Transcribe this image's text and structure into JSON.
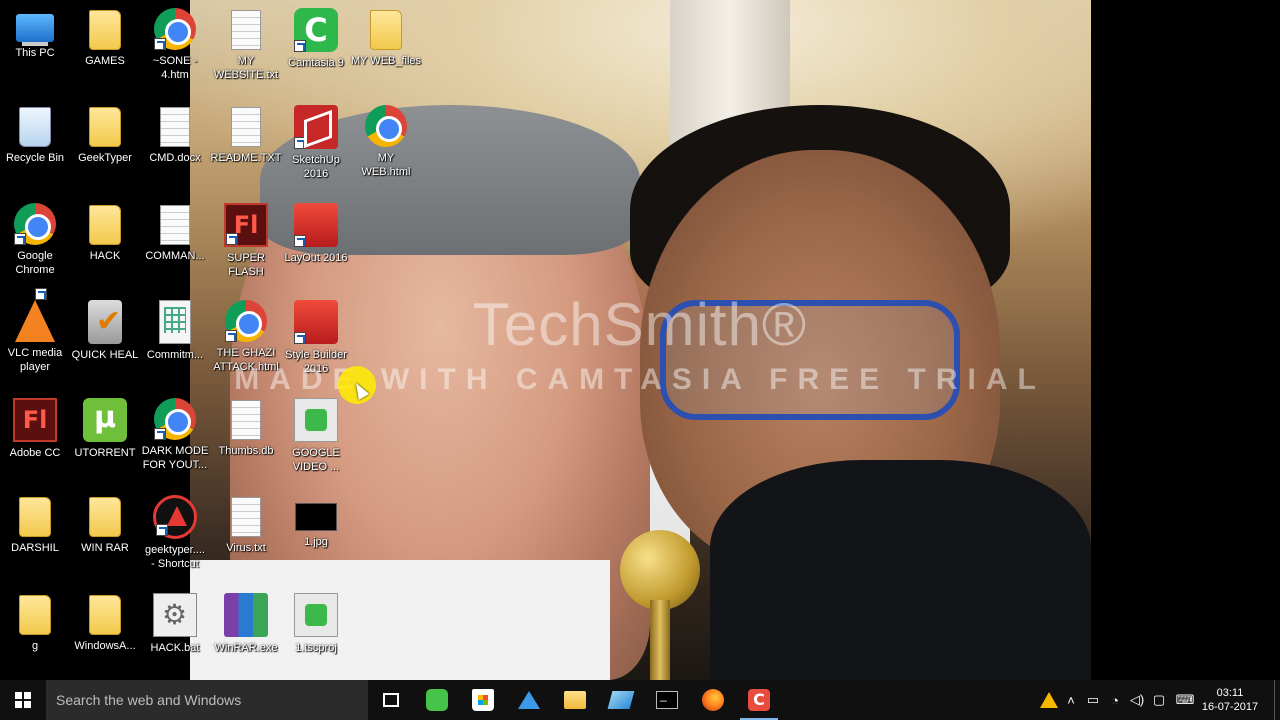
{
  "watermark": {
    "brand": "TechSmith®",
    "trial": "MADE WITH CAMTASIA FREE TRIAL"
  },
  "desktop_icons": [
    {
      "id": "this-pc",
      "label": "This PC",
      "icon": "computer-icon"
    },
    {
      "id": "games",
      "label": "GAMES",
      "icon": "folder-icon"
    },
    {
      "id": "sone",
      "label": "~SONE -\n4.htm",
      "icon": "chrome-icon"
    },
    {
      "id": "my-website",
      "label": "MY\nWEBSITE.txt",
      "icon": "text-file-icon"
    },
    {
      "id": "camtasia9",
      "label": "Camtasia 9",
      "icon": "camtasia-icon"
    },
    {
      "id": "my-web-files",
      "label": "MY WEB_files",
      "icon": "folder-icon"
    },
    {
      "id": "recycle-bin",
      "label": "Recycle Bin",
      "icon": "recycle-bin-icon"
    },
    {
      "id": "geektyper",
      "label": "GeekTyper",
      "icon": "folder-icon"
    },
    {
      "id": "cmd-docx",
      "label": "CMD.docx",
      "icon": "word-doc-icon"
    },
    {
      "id": "readme",
      "label": "README.TXT",
      "icon": "text-file-icon"
    },
    {
      "id": "sketchup",
      "label": "SketchUp\n2016",
      "icon": "sketchup-icon"
    },
    {
      "id": "my-web-html",
      "label": "MY\nWEB.html",
      "icon": "chrome-icon"
    },
    {
      "id": "google-chrome",
      "label": "Google\nChrome",
      "icon": "chrome-icon"
    },
    {
      "id": "hack",
      "label": "HACK",
      "icon": "folder-icon"
    },
    {
      "id": "command",
      "label": "COMMAN...",
      "icon": "text-file-icon"
    },
    {
      "id": "super-flash",
      "label": "SUPER\nFLASH",
      "icon": "flash-icon"
    },
    {
      "id": "layout",
      "label": "LayOut 2016",
      "icon": "layout-icon"
    },
    {
      "id": "vlc",
      "label": "VLC media\nplayer",
      "icon": "vlc-icon"
    },
    {
      "id": "quick-heal",
      "label": "QUICK HEAL",
      "icon": "quick-heal-icon"
    },
    {
      "id": "commitment",
      "label": "Commitm...",
      "icon": "spreadsheet-icon"
    },
    {
      "id": "ghazi",
      "label": "THE GHAZI\nATTACK.html",
      "icon": "chrome-icon"
    },
    {
      "id": "style-builder",
      "label": "Style Builder\n2016",
      "icon": "style-builder-icon"
    },
    {
      "id": "adobe-cc",
      "label": "Adobe CC",
      "icon": "flash-icon"
    },
    {
      "id": "utorrent",
      "label": "UTORRENT",
      "icon": "utorrent-icon"
    },
    {
      "id": "dark-mode",
      "label": "DARK MODE\nFOR YOUT...",
      "icon": "chrome-icon"
    },
    {
      "id": "thumbs",
      "label": "Thumbs.db",
      "icon": "database-file-icon"
    },
    {
      "id": "google-video",
      "label": "GOOGLE\nVIDEO ...",
      "icon": "video-file-icon"
    },
    {
      "id": "darshil",
      "label": "DARSHIL",
      "icon": "folder-icon"
    },
    {
      "id": "winrar-folder",
      "label": "WIN RAR",
      "icon": "folder-icon"
    },
    {
      "id": "geektyper-shortcut",
      "label": "geektyper....\n- Shortcut",
      "icon": "geektyper-icon"
    },
    {
      "id": "virus",
      "label": "Virus.txt",
      "icon": "text-file-icon"
    },
    {
      "id": "one-jpg",
      "label": "1.jpg",
      "icon": "image-file-icon"
    },
    {
      "id": "g",
      "label": "g",
      "icon": "folder-icon"
    },
    {
      "id": "windowsa",
      "label": "WindowsA...",
      "icon": "folder-icon"
    },
    {
      "id": "hack-bat",
      "label": "HACK.bat",
      "icon": "batch-file-icon"
    },
    {
      "id": "winrar-exe",
      "label": "WinRAR.exe",
      "icon": "winrar-icon"
    },
    {
      "id": "tscproj",
      "label": "1.tscproj",
      "icon": "camtasia-project-icon"
    }
  ],
  "taskbar": {
    "search_placeholder": "Search the web and Windows",
    "pinned": [
      "task-view-icon",
      "evernote-icon",
      "store-icon",
      "dropbox-icon",
      "file-explorer-icon",
      "paint-icon",
      "command-prompt-icon",
      "firefox-icon",
      "camtasia-icon"
    ],
    "active": "camtasia-icon",
    "clock_time": "03:11",
    "clock_date": "16-07-2017"
  },
  "colors": {
    "taskbar_bg": "#101010",
    "search_bg": "#2b2b2b",
    "active_indicator": "#7fb4e6",
    "cursor_highlight": "#ffec00"
  }
}
